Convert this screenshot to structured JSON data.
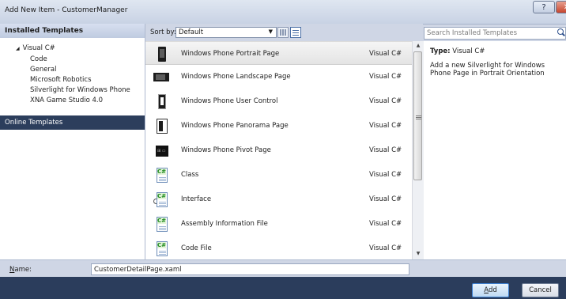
{
  "window": {
    "title": "Add New Item - CustomerManager",
    "help_glyph": "?",
    "close_glyph": "✕"
  },
  "left": {
    "header": "Installed Templates",
    "tree_root": {
      "label": "Visual C#",
      "expander": "◢"
    },
    "tree_items": [
      {
        "label": "Code"
      },
      {
        "label": "General"
      },
      {
        "label": "Microsoft Robotics"
      },
      {
        "label": "Silverlight for Windows Phone"
      },
      {
        "label": "XNA Game Studio 4.0"
      }
    ],
    "online": "Online Templates"
  },
  "sort": {
    "label": "Sort by:",
    "value": "Default",
    "arrow": "▼"
  },
  "templates": [
    {
      "name": "Windows Phone Portrait Page",
      "lang": "Visual C#",
      "icon": "phone-portrait-icon",
      "selected": true
    },
    {
      "name": "Windows Phone Landscape Page",
      "lang": "Visual C#",
      "icon": "phone-landscape-icon"
    },
    {
      "name": "Windows Phone User Control",
      "lang": "Visual C#",
      "icon": "phone-user-control-icon"
    },
    {
      "name": "Windows Phone Panorama Page",
      "lang": "Visual C#",
      "icon": "phone-panorama-icon"
    },
    {
      "name": "Windows Phone Pivot Page",
      "lang": "Visual C#",
      "icon": "phone-pivot-icon"
    },
    {
      "name": "Class",
      "lang": "Visual C#",
      "icon": "csharp-class-icon"
    },
    {
      "name": "Interface",
      "lang": "Visual C#",
      "icon": "csharp-interface-icon"
    },
    {
      "name": "Assembly Information File",
      "lang": "Visual C#",
      "icon": "csharp-file-icon"
    },
    {
      "name": "Code File",
      "lang": "Visual C#",
      "icon": "csharp-code-file-icon"
    }
  ],
  "scroll": {
    "up": "▲",
    "down": "▼"
  },
  "search": {
    "placeholder": "Search Installed Templates"
  },
  "details": {
    "type_label": "Type:",
    "type_value": "Visual C#",
    "description": "Add a new Silverlight for Windows Phone Page in Portrait Orientation"
  },
  "name_field": {
    "label_prefix": "N",
    "label_rest": "ame:",
    "value": "CustomerDetailPage.xaml"
  },
  "buttons": {
    "add_prefix": "A",
    "add_rest": "dd",
    "cancel": "Cancel"
  },
  "colors": {
    "selected_row": "#e6e6e6",
    "online_bg": "#2c3e5c",
    "bottom_bar": "#2b3d5c"
  }
}
